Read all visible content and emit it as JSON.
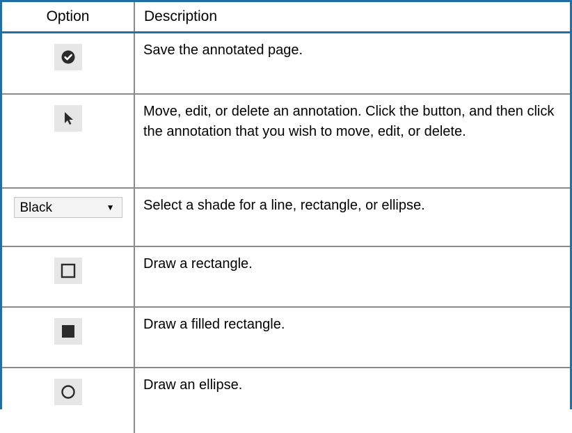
{
  "table": {
    "headers": {
      "option": "Option",
      "description": "Description"
    },
    "rows": [
      {
        "icon": "checkmark-circle-icon",
        "description": "Save the annotated page."
      },
      {
        "icon": "arrow-pointer-icon",
        "description": "Move, edit, or delete an annotation. Click the button, and then click the annotation that you wish to move, edit, or delete."
      },
      {
        "icon": "shade-select",
        "select_value": "Black",
        "description": "Select a shade for a line, rectangle, or ellipse."
      },
      {
        "icon": "rectangle-outline-icon",
        "description": "Draw a rectangle."
      },
      {
        "icon": "filled-rectangle-icon",
        "description": "Draw a filled rectangle."
      },
      {
        "icon": "ellipse-outline-icon",
        "description": "Draw an ellipse."
      }
    ]
  },
  "colors": {
    "header_rule": "#1f6fa8",
    "icon_dark": "#2b2b2b",
    "icon_button_bg": "#e6e6e6"
  }
}
